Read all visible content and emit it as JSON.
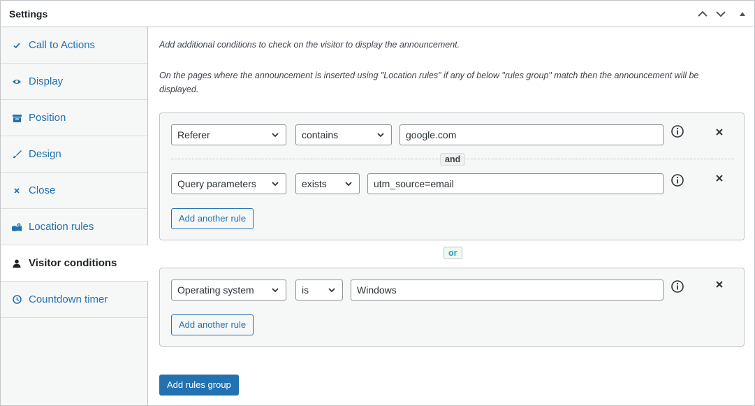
{
  "panel": {
    "title": "Settings",
    "controls": [
      "move-up",
      "move-down",
      "collapse"
    ]
  },
  "sidebar": {
    "tabs": [
      {
        "label": "Call to Actions",
        "icon": "check-icon"
      },
      {
        "label": "Display",
        "icon": "eye-icon"
      },
      {
        "label": "Position",
        "icon": "archive-icon"
      },
      {
        "label": "Design",
        "icon": "brush-icon"
      },
      {
        "label": "Close",
        "icon": "close-icon"
      },
      {
        "label": "Location rules",
        "icon": "location-icon"
      },
      {
        "label": "Visitor conditions",
        "icon": "user-icon",
        "active": true
      },
      {
        "label": "Countdown timer",
        "icon": "clock-icon"
      }
    ]
  },
  "content": {
    "description_1": "Add additional conditions to check on the visitor to display the announcement.",
    "description_2": "On the pages where the announcement is inserted using \"Location rules\" if any of below \"rules group\" match then the announcement will be displayed.",
    "groups": [
      {
        "rules": [
          {
            "field": "Referer",
            "operator": "contains",
            "value": "google.com"
          },
          {
            "field": "Query parameters",
            "operator": "exists",
            "value": "utm_source=email"
          }
        ],
        "joiner": "and",
        "add_rule_label": "Add another rule"
      },
      {
        "rules": [
          {
            "field": "Operating system",
            "operator": "is",
            "value": "Windows"
          }
        ],
        "add_rule_label": "Add another rule"
      }
    ],
    "group_joiner": "or",
    "add_group_label": "Add rules group"
  },
  "colors": {
    "accent": "#2271b1",
    "or_badge_text": "#2a9cb5",
    "border": "#c3c4c7"
  }
}
